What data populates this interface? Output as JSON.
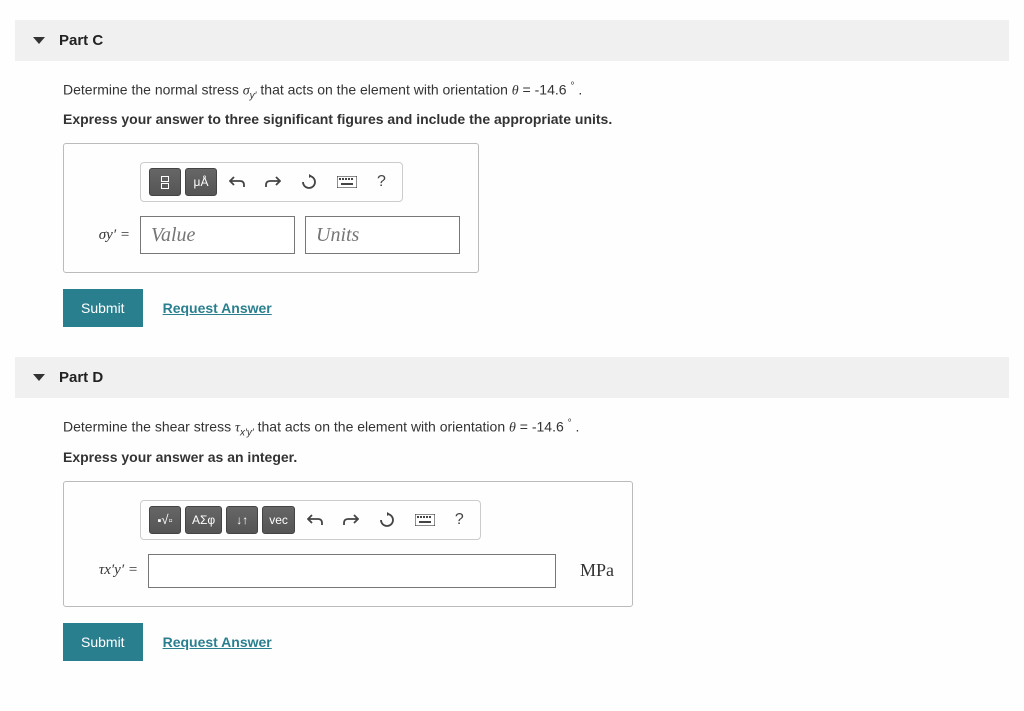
{
  "partC": {
    "title": "Part C",
    "prompt_prefix": "Determine the normal stress ",
    "sigma_var": "σ",
    "sigma_sub": "y′",
    "prompt_mid": " that acts on the element with orientation ",
    "theta": "θ",
    "equals": " = -14.6 ",
    "degree": "°",
    "period": " .",
    "instruction": "Express your answer to three significant figures and include the appropriate units.",
    "toolbar": {
      "mu_a": "μÅ",
      "help": "?"
    },
    "var_label": "σy′ =",
    "value_placeholder": "Value",
    "units_placeholder": "Units",
    "submit": "Submit",
    "request": "Request Answer"
  },
  "partD": {
    "title": "Part D",
    "prompt_prefix": "Determine the shear stress ",
    "tau_var": "τ",
    "tau_sub": "x′y′",
    "prompt_mid": " that acts on the element with orientation ",
    "theta": "θ",
    "equals": " = -14.6 ",
    "degree": "°",
    "period": " .",
    "instruction": "Express your answer as an integer.",
    "toolbar": {
      "greek": "ΑΣφ",
      "updown": "↓↑",
      "vec": "vec",
      "help": "?"
    },
    "var_label": "τx′y′ =",
    "unit": "MPa",
    "submit": "Submit",
    "request": "Request Answer"
  }
}
